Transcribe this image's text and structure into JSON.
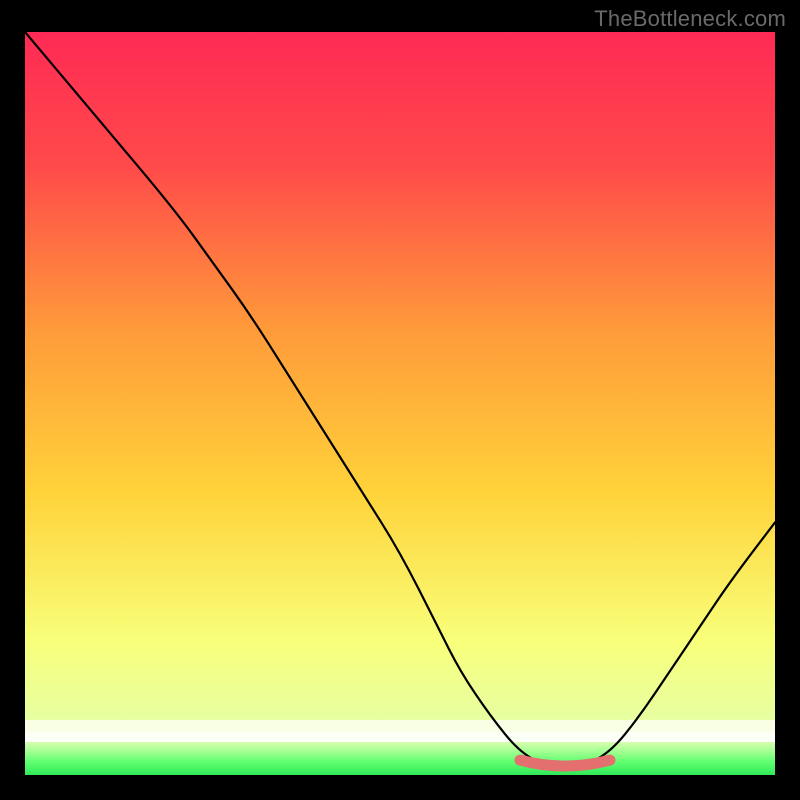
{
  "watermark": {
    "text": "TheBottleneck.com"
  },
  "chart_data": {
    "type": "line",
    "title": "",
    "xlabel": "",
    "ylabel": "",
    "xlim": [
      0,
      100
    ],
    "ylim": [
      0,
      100
    ],
    "gradient_colors": {
      "top": "#ff2a55",
      "upper_mid": "#ff6a3a",
      "mid": "#ffd33a",
      "lower": "#f8ff7a",
      "bottom_band": "#3cff66"
    },
    "curve": {
      "description": "V-shaped bottleneck curve. Left arm starts at top-left corner and descends steeply to a flat minimum near x≈68–76, then rises toward the right edge at roughly 30% height.",
      "x": [
        0,
        10,
        20,
        25,
        30,
        35,
        40,
        45,
        50,
        55,
        58,
        62,
        66,
        70,
        74,
        78,
        82,
        86,
        90,
        94,
        100
      ],
      "y": [
        100,
        88,
        76,
        69,
        62,
        54,
        46,
        38,
        30,
        20,
        14,
        8,
        3,
        1,
        1,
        3,
        8,
        14,
        20,
        26,
        34
      ]
    },
    "highlight": {
      "description": "Short salmon segment marking the flat minimum of the curve",
      "x_range": [
        66,
        78
      ],
      "y": 1.2,
      "color": "#e36f6f"
    }
  }
}
